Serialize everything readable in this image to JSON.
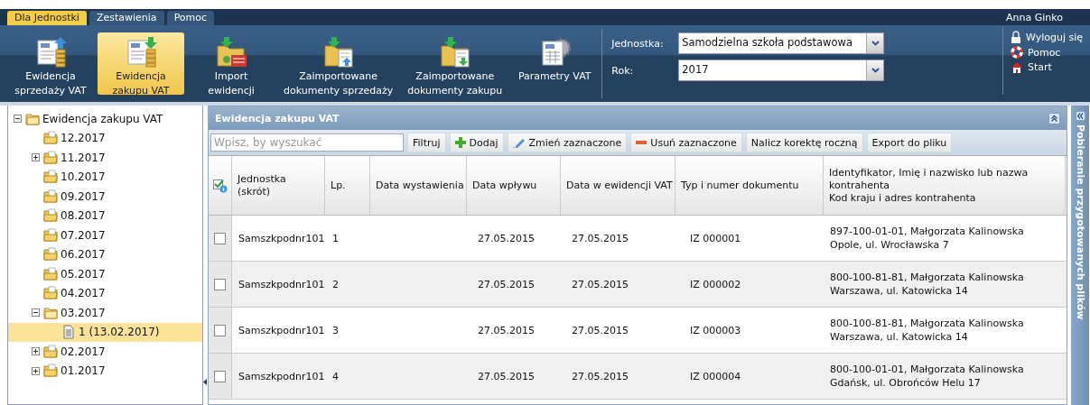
{
  "top_tabs": [
    {
      "label": "Dla Jednostki",
      "selected": true
    },
    {
      "label": "Zestawienia",
      "selected": false
    },
    {
      "label": "Pomoc",
      "selected": false
    }
  ],
  "user": "Anna Ginko",
  "ribbon": {
    "items": [
      {
        "label": "Ewidencja\nsprzedaży VAT",
        "kind": "sales",
        "selected": false
      },
      {
        "label": "Ewidencja\nzakupu VAT",
        "kind": "purchase",
        "selected": true
      },
      {
        "label": "Import\newidencji",
        "kind": "import",
        "selected": false
      },
      {
        "label": "Zaimportowane\ndokumenty sprzedaży",
        "kind": "salesdocs",
        "selected": false
      },
      {
        "label": "Zaimportowane\ndokumenty zakupu",
        "kind": "purchasedocs",
        "selected": false
      },
      {
        "label": "Parametry VAT",
        "kind": "settings",
        "selected": false
      }
    ],
    "filters": [
      {
        "label": "Jednostka:",
        "value": "Samodzielna szkoła podstawowa"
      },
      {
        "label": "Rok:",
        "value": "2017"
      }
    ],
    "links": [
      {
        "label": "Wyloguj się",
        "kind": "lock"
      },
      {
        "label": "Pomoc",
        "kind": "help"
      },
      {
        "label": "Start",
        "kind": "home"
      }
    ]
  },
  "tree": {
    "items": [
      {
        "label": "Ewidencja zakupu VAT",
        "expanded": true,
        "selected": false,
        "children": [
          {
            "label": "12.2017",
            "selected": false
          },
          {
            "label": "11.2017",
            "expanded": false,
            "selected": false
          },
          {
            "label": "10.2017",
            "selected": false
          },
          {
            "label": "09.2017",
            "selected": false
          },
          {
            "label": "08.2017",
            "selected": false
          },
          {
            "label": "07.2017",
            "selected": false
          },
          {
            "label": "06.2017",
            "selected": false
          },
          {
            "label": "05.2017",
            "selected": false
          },
          {
            "label": "04.2017",
            "selected": false
          },
          {
            "label": "03.2017",
            "expanded": true,
            "selected": false,
            "children": [
              {
                "label": "1 (13.02.2017)",
                "selected": true
              }
            ]
          },
          {
            "label": "02.2017",
            "expanded": false,
            "selected": false
          },
          {
            "label": "01.2017",
            "expanded": false,
            "selected": false
          }
        ]
      }
    ]
  },
  "panel": {
    "title": "Ewidencja zakupu VAT",
    "search": {
      "placeholder": "Wpisz, by wyszukać"
    },
    "buttons": [
      {
        "label": "Filtruj",
        "kind": "plain"
      },
      {
        "label": "Dodaj",
        "kind": "add"
      },
      {
        "label": "Zmień zaznaczone",
        "kind": "edit"
      },
      {
        "label": "Usuń zaznaczone",
        "kind": "remove"
      },
      {
        "label": "Nalicz korektę roczną",
        "kind": "plain"
      },
      {
        "label": "Export do pliku",
        "kind": "plain"
      }
    ],
    "table": {
      "columns": [
        "Jednostka\n(skrót)",
        "Lp.",
        "Data wystawienia",
        "Data wpływu",
        "Data w ewidencji VAT",
        "Typ i numer dokumentu",
        "Identyfikator, Imię i nazwisko lub nazwa kontrahenta\nKod kraju i adres kontrahenta"
      ],
      "rows": [
        {
          "checked": false,
          "cells": [
            "Samszkpodnr101",
            "1",
            "",
            "27.05.2015",
            "27.05.2015",
            "IZ 000001",
            "897-100-01-01, Małgorzata Kalinowska\nOpole, ul. Wrocławska 7"
          ]
        },
        {
          "checked": false,
          "cells": [
            "Samszkpodnr101",
            "2",
            "",
            "27.05.2015",
            "27.05.2015",
            "IZ 000002",
            "800-100-81-81, Małgorzata Kalinowska\nWarszawa, ul. Katowicka 14"
          ]
        },
        {
          "checked": false,
          "cells": [
            "Samszkpodnr101",
            "3",
            "",
            "27.05.2015",
            "27.05.2015",
            "IZ 000003",
            "800-100-81-81, Małgorzata Kalinowska\nWarszawa, ul. Katowicka 14"
          ]
        },
        {
          "checked": false,
          "cells": [
            "Samszkpodnr101",
            "4",
            "",
            "27.05.2015",
            "27.05.2015",
            "IZ 000004",
            "800-100-01-01, Małgorzata Kalinowska\nGdańsk, ul. Obrońców Helu 17"
          ]
        }
      ]
    }
  },
  "side_panel": {
    "title": "Pobieranie przygotowanych plików"
  }
}
